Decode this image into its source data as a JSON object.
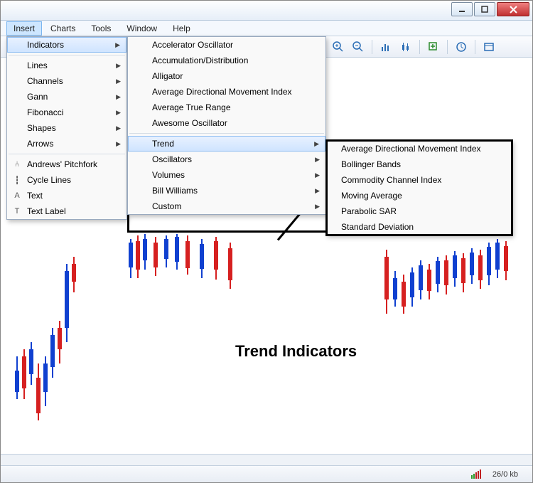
{
  "menubar": {
    "insert": "Insert",
    "charts": "Charts",
    "tools": "Tools",
    "window": "Window",
    "help": "Help"
  },
  "insert_menu": {
    "indicators": "Indicators",
    "lines": "Lines",
    "channels": "Channels",
    "gann": "Gann",
    "fibonacci": "Fibonacci",
    "shapes": "Shapes",
    "arrows": "Arrows",
    "andrews_pitchfork": "Andrews' Pitchfork",
    "cycle_lines": "Cycle Lines",
    "text": "Text",
    "text_label": "Text Label"
  },
  "indicators_menu": {
    "accelerator_oscillator": "Accelerator Oscillator",
    "accumulation_distribution": "Accumulation/Distribution",
    "alligator": "Alligator",
    "adx": "Average Directional Movement Index",
    "atr": "Average True Range",
    "awesome_oscillator": "Awesome Oscillator",
    "trend": "Trend",
    "oscillators": "Oscillators",
    "volumes": "Volumes",
    "bill_williams": "Bill Williams",
    "custom": "Custom"
  },
  "trend_menu": {
    "adx": "Average Directional Movement Index",
    "bollinger": "Bollinger Bands",
    "cci": "Commodity Channel Index",
    "ma": "Moving Average",
    "psar": "Parabolic SAR",
    "stddev": "Standard Deviation"
  },
  "annotation": {
    "label": "Trend Indicators"
  },
  "status": {
    "kb": "26/0 kb"
  },
  "icons": {
    "text_a": "A",
    "text_t": "T"
  }
}
